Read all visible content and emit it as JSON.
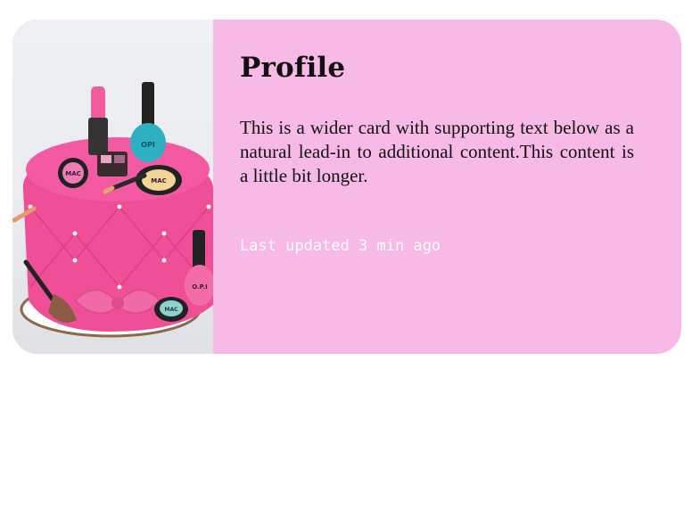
{
  "card": {
    "title": "Profile",
    "text": "This is a wider card with supporting text below as a natural lead-in to additional content.This content is a little bit longer.",
    "updated": "Last updated 3 min ago",
    "image": {
      "labels": {
        "palette_left": "MAC",
        "palette_right": "MAC",
        "nail_polish_top": "OPI",
        "nail_polish_bottom": "O.P.I",
        "compact_bottom": "MAC"
      }
    }
  },
  "colors": {
    "card_bg": "#f7b9e6",
    "title": "#111111",
    "muted_text": "#ffffff"
  }
}
